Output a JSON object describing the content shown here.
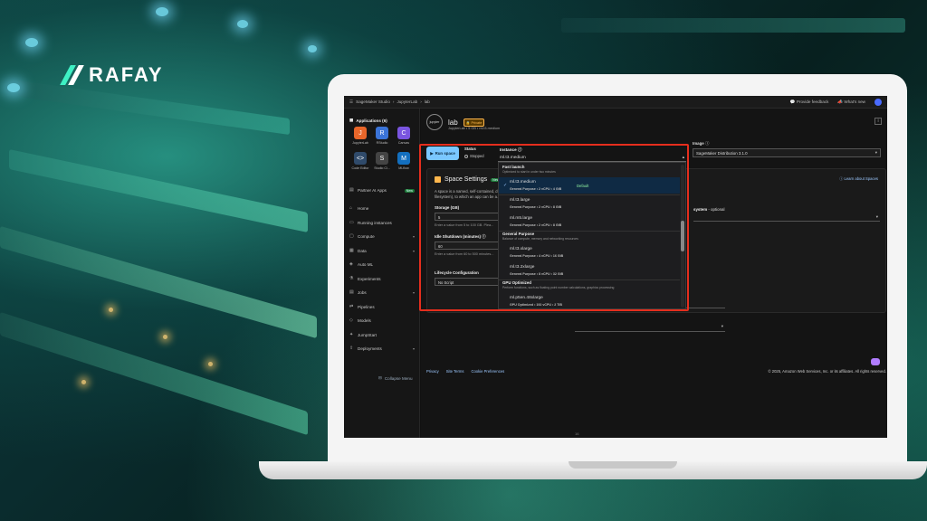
{
  "brand": {
    "text": "RAFAY"
  },
  "topbar": {
    "breadcrumb": [
      "SageMaker Studio",
      "JupyterLab",
      "lab"
    ],
    "feedback": "Provide feedback",
    "whats_new": "What's new"
  },
  "sidebar": {
    "apps_title": "Applications (6)",
    "apps": [
      {
        "label": "JupyterLab",
        "color": "#e8662a",
        "glyph": "J"
      },
      {
        "label": "RStudio",
        "color": "#3b74d8",
        "glyph": "R"
      },
      {
        "label": "Canvas",
        "color": "#7a55e0",
        "glyph": "C"
      },
      {
        "label": "Code Editor",
        "color": "#2f4a6a",
        "glyph": "<>"
      },
      {
        "label": "Studio Cl...",
        "color": "#444",
        "glyph": "S"
      },
      {
        "label": "MLflow",
        "color": "#136fbf",
        "glyph": "M"
      }
    ],
    "partner": "Partner AI Apps",
    "new_tag": "New",
    "nav": [
      "Home",
      "Running instances",
      "Compute",
      "Data",
      "Auto ML",
      "Experiments",
      "Jobs",
      "Pipelines",
      "Models",
      "JumpStart",
      "Deployments"
    ],
    "collapse": "Collapse Menu"
  },
  "main": {
    "title": "lab",
    "badge": "Private",
    "sub": "JupyterLab • 5 GB • ml.t3.medium",
    "run_label": "Run space",
    "status_label": "Status",
    "status_value": "Stopped",
    "image_label": "Image",
    "image_value": "SageMaker Distribution 3.1.0",
    "settings_title": "Space Settings",
    "settings_tag": "New",
    "learn": "Learn about Spaces",
    "desc": "A space is a named, self-contained, d... filesystem), to which an app can be a...",
    "storage_label": "Storage (GB)",
    "storage_value": "5",
    "storage_help": "Enter a value from 5 to 100 GB. Plea...",
    "idle_label": "Idle Shutdown (minutes)",
    "idle_value": "60",
    "idle_help": "Enter a value from 60 to 500 minutes...",
    "lifecycle_label": "Lifecycle Configuration",
    "lifecycle_value": "No Script",
    "fs_label": "system",
    "fs_optional": "- optional",
    "footer": [
      "Privacy",
      "Site Terms",
      "Cookie Preferences"
    ],
    "copyright": "© 2025, Amazon Web Services, Inc. or its affiliates. All rights reserved.",
    "page_num": "16"
  },
  "instance": {
    "label": "Instance",
    "value": "ml.t3.medium",
    "groups": [
      {
        "name": "Fast launch",
        "desc": "Optimized to start in under two minutes",
        "options": [
          {
            "name": "ml.t3.medium",
            "spec": "General Purpose • 2 vCPU • 4 GiB",
            "selected": true,
            "default": "Default"
          }
        ]
      },
      {
        "name": "",
        "desc": "",
        "options": [
          {
            "name": "ml.t3.large",
            "spec": "General Purpose • 2 vCPU • 8 GiB"
          },
          {
            "name": "ml.m5.large",
            "spec": "General Purpose • 2 vCPU • 8 GiB"
          }
        ]
      },
      {
        "name": "General Purpose",
        "desc": "Balance of compute, memory and networking resources",
        "options": [
          {
            "name": "ml.t3.xlarge",
            "spec": "General Purpose • 4 vCPU • 16 GiB"
          },
          {
            "name": "ml.t3.2xlarge",
            "spec": "General Purpose • 8 vCPU • 32 GiB"
          }
        ]
      },
      {
        "name": "GPU Optimized",
        "desc": "Perform functions, such as floating point number calculations, graphics processing",
        "options": [
          {
            "name": "ml.p5en.48xlarge",
            "spec": "GPU Optimized • 192 vCPU • 2 TiB"
          }
        ]
      }
    ]
  },
  "colors": {
    "highlight": "#e52e1d",
    "accent": "#7ac7ff"
  }
}
